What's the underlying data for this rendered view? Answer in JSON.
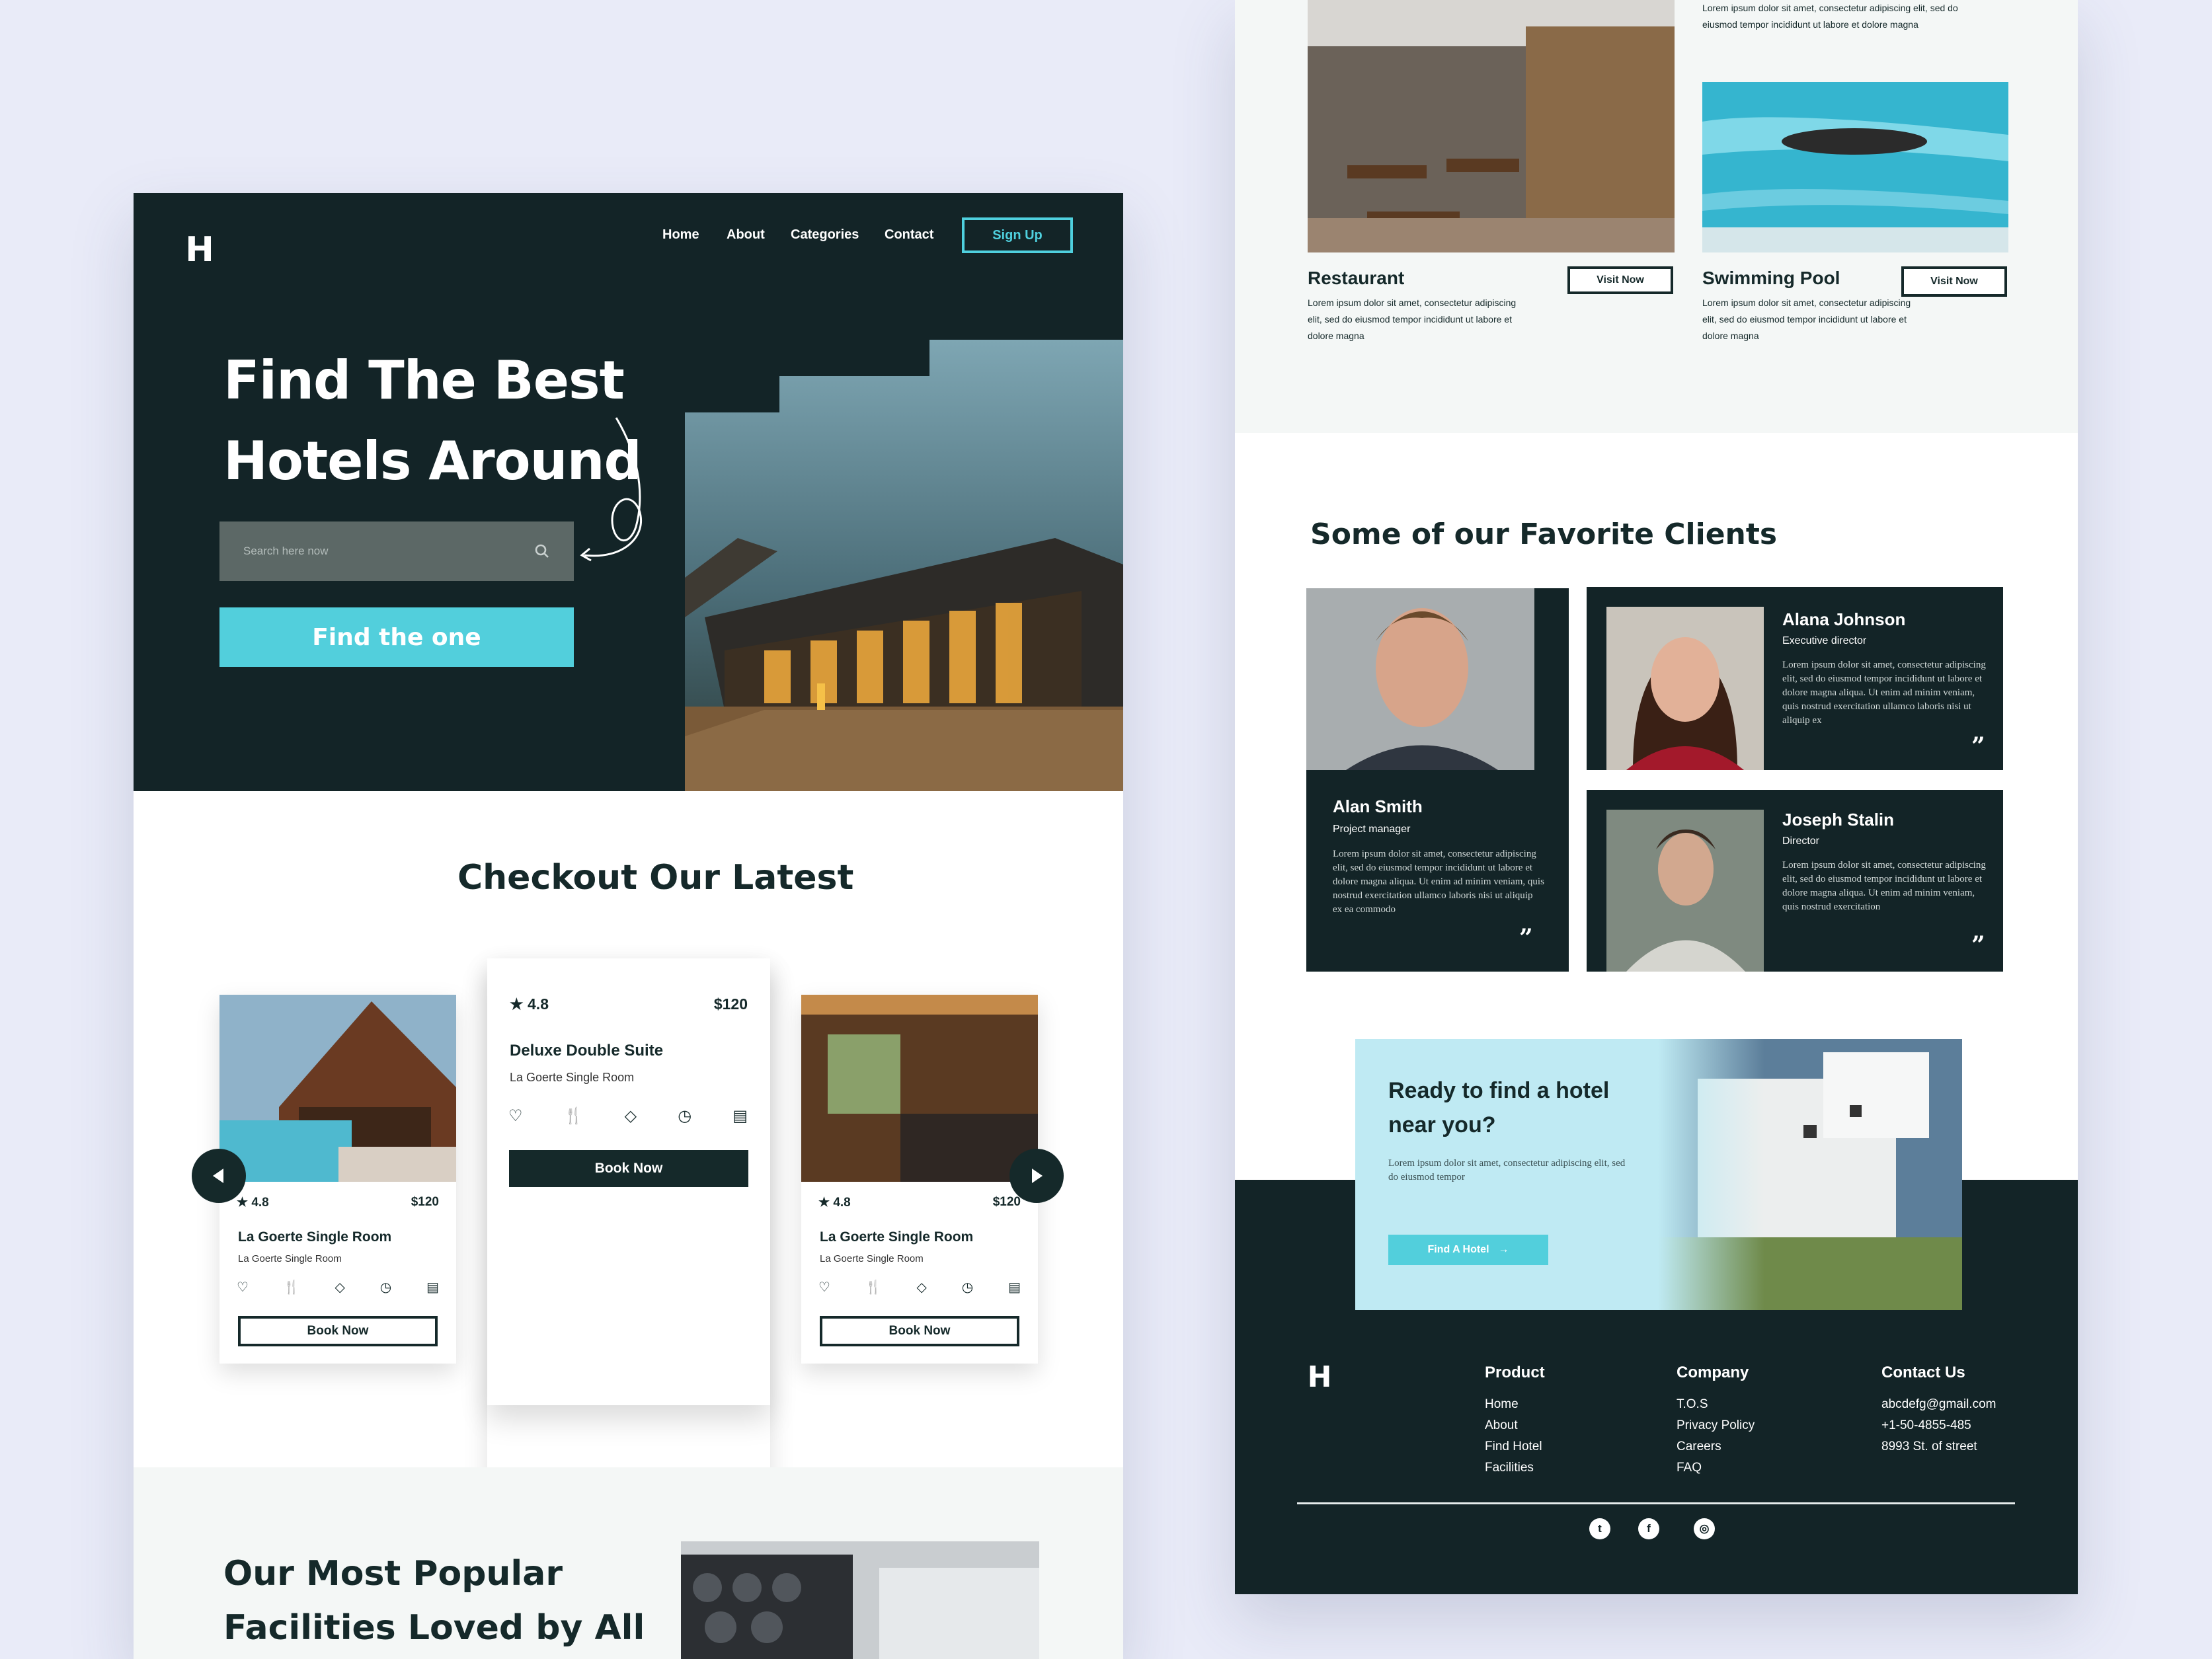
{
  "nav": {
    "logo": "H",
    "links": [
      "Home",
      "About",
      "Categories",
      "Contact"
    ],
    "signup": "Sign Up"
  },
  "hero": {
    "title_line1": "Find The Best",
    "title_line2": "Hotels Around",
    "search_placeholder": "Search here now",
    "cta": "Find the one"
  },
  "latest": {
    "title": "Checkout Our Latest",
    "cards": [
      {
        "rating": "4.8",
        "price": "$120",
        "title": "La Goerte Single Room",
        "subtitle": "La Goerte Single Room",
        "button": "Book Now"
      },
      {
        "rating": "4.8",
        "price": "$120",
        "title": "Deluxe Double Suite",
        "subtitle": "La Goerte Single Room",
        "button": "Book Now"
      },
      {
        "rating": "4.8",
        "price": "$120",
        "title": "La Goerte Single Room",
        "subtitle": "La Goerte Single Room",
        "button": "Book Now"
      }
    ],
    "card_icons": [
      "heart-icon",
      "fork-knife-icon",
      "diamond-icon",
      "clock-icon",
      "chat-icon"
    ]
  },
  "facilities": {
    "title_line1": "Our Most Popular",
    "title_line2": "Facilities Loved by All"
  },
  "right_facilities": {
    "top_desc": "Lorem ipsum dolor sit amet, consectetur adipiscing elit, sed do eiusmod tempor incididunt ut labore et dolore magna",
    "items": [
      {
        "title": "Restaurant",
        "desc": "Lorem ipsum dolor sit amet, consectetur adipiscing elit, sed do eiusmod tempor incididunt ut labore et dolore magna",
        "button": "Visit Now"
      },
      {
        "title": "Swimming Pool",
        "desc": "Lorem ipsum dolor sit amet, consectetur adipiscing elit, sed do eiusmod tempor incididunt ut labore et dolore magna",
        "button": "Visit Now"
      }
    ]
  },
  "clients": {
    "title": "Some of our Favorite Clients",
    "items": [
      {
        "name": "Alan Smith",
        "role": "Project manager",
        "quote": "Lorem ipsum dolor sit amet, consectetur adipiscing elit, sed do eiusmod tempor incididunt ut labore et dolore magna aliqua. Ut enim ad minim veniam, quis nostrud exercitation ullamco laboris nisi ut aliquip ex ea commodo"
      },
      {
        "name": "Alana Johnson",
        "role": "Executive director",
        "quote": "Lorem ipsum dolor sit amet, consectetur adipiscing elit, sed do eiusmod tempor incididunt ut labore et dolore magna aliqua. Ut enim ad minim veniam, quis nostrud exercitation ullamco laboris nisi ut aliquip ex"
      },
      {
        "name": "Joseph Stalin",
        "role": "Director",
        "quote": "Lorem ipsum dolor sit amet, consectetur adipiscing elit, sed do eiusmod tempor incididunt ut labore et dolore magna aliqua. Ut enim ad minim veniam, quis nostrud exercitation"
      }
    ],
    "quote_mark": "”"
  },
  "cta_block": {
    "title_line1": "Ready to find a hotel",
    "title_line2": "near you?",
    "desc": "Lorem ipsum dolor sit amet, consectetur adipiscing elit, sed do eiusmod tempor",
    "button": "Find A Hotel"
  },
  "footer": {
    "logo": "H",
    "columns": [
      {
        "title": "Product",
        "items": [
          "Home",
          "About",
          "Find Hotel",
          "Facilities"
        ]
      },
      {
        "title": "Company",
        "items": [
          "T.O.S",
          "Privacy Policy",
          "Careers",
          "FAQ"
        ]
      },
      {
        "title": "Contact Us",
        "items": [
          "abcdefg@gmail.com",
          "+1-50-4855-485",
          "8993 St. of street"
        ]
      }
    ],
    "social": [
      {
        "icon": "twitter-icon",
        "glyph": "t"
      },
      {
        "icon": "facebook-icon",
        "glyph": "f"
      },
      {
        "icon": "instagram-icon",
        "glyph": "◎"
      }
    ]
  },
  "colors": {
    "dark": "#132427",
    "accent": "#52cfdc",
    "background": "#e9ebf8",
    "light_section": "#f4f7f6",
    "cta_bg": "#bfeaf3"
  }
}
